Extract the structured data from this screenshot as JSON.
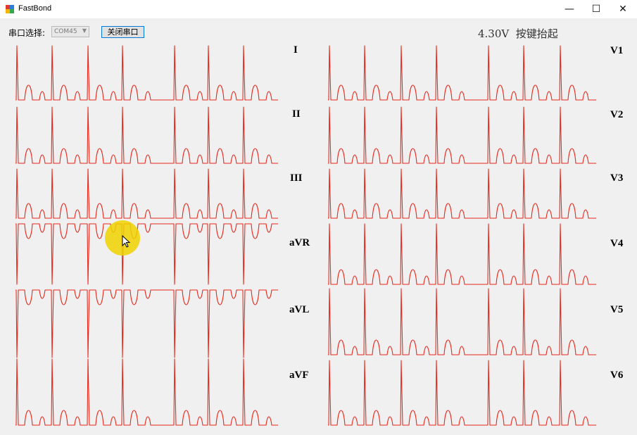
{
  "window": {
    "title": "FastBond",
    "controls": {
      "minimize": "—",
      "maximize": "☐",
      "close": "✕"
    }
  },
  "toolbar": {
    "port_label": "串口选择:",
    "port_value": "COM45",
    "close_port_label": "关闭串口",
    "status_text": "4.30V  按键抬起"
  },
  "leads": {
    "left": [
      {
        "name": "I",
        "shape": "normal"
      },
      {
        "name": "II",
        "shape": "normal"
      },
      {
        "name": "III",
        "shape": "normal"
      },
      {
        "name": "aVR",
        "shape": "inverted"
      },
      {
        "name": "aVL",
        "shape": "inverted"
      },
      {
        "name": "aVF",
        "shape": "normal"
      }
    ],
    "right": [
      {
        "name": "V1",
        "shape": "normal"
      },
      {
        "name": "V2",
        "shape": "normal"
      },
      {
        "name": "V3",
        "shape": "normal"
      },
      {
        "name": "V4",
        "shape": "normal"
      },
      {
        "name": "V5",
        "shape": "normal"
      },
      {
        "name": "V6",
        "shape": "normal"
      }
    ]
  },
  "colors": {
    "trace": "#e8291c",
    "background": "#f0f0f0",
    "cursor_highlight": "#f2d000"
  }
}
